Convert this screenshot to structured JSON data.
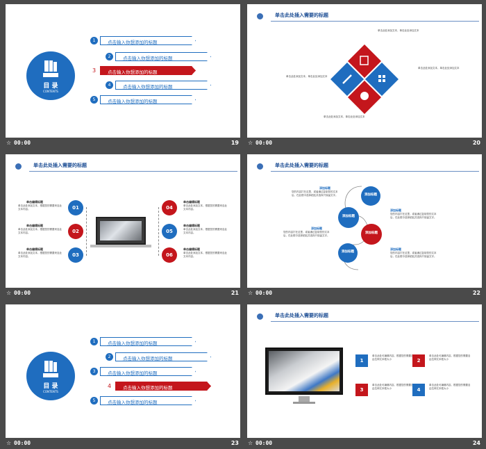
{
  "slides": {
    "s19": {
      "number": "19",
      "duration": "00:00"
    },
    "s20": {
      "number": "20",
      "duration": "00:00"
    },
    "s21": {
      "number": "21",
      "duration": "00:00"
    },
    "s22": {
      "number": "22",
      "duration": "00:00"
    },
    "s23": {
      "number": "23",
      "duration": "00:00"
    },
    "s24": {
      "number": "24",
      "duration": "00:00"
    }
  },
  "header_title": "单击此处插入需要的标题",
  "toc": {
    "title": "目 录",
    "subtitle": "CONTENTS",
    "items": [
      {
        "num": "1",
        "label": "点击输入你想添加的标题"
      },
      {
        "num": "2",
        "label": "点击输入你想添加的标题"
      },
      {
        "num": "3",
        "label": "点击输入你想添加的标题"
      },
      {
        "num": "4",
        "label": "点击输入你想添加的标题"
      },
      {
        "num": "5",
        "label": "点击输入你想添加的标题"
      }
    ]
  },
  "s20_text": "单击此处添加文本，单击此处添加文本",
  "s21": {
    "item_title": "单击编辑标题",
    "item_text": "单击此处添加文本，根据您的需要来自此文本内容。",
    "numbers": [
      "01",
      "02",
      "03",
      "04",
      "05",
      "06"
    ]
  },
  "s22": {
    "circle_label": "添加标题",
    "item_title": "添加标题",
    "item_text": "您的内容打在这里，或者通过复制您的文本后，在此框中选择粘贴并选择只保留文字。"
  },
  "s24": {
    "text": "单击此处可编辑内容，根据您的需要自由拉伸文本框大小",
    "numbers": [
      "1",
      "2",
      "3",
      "4"
    ]
  },
  "colors": {
    "blue": "#1f6dbf",
    "red": "#c4161c",
    "bg": "#4a4a4a"
  }
}
